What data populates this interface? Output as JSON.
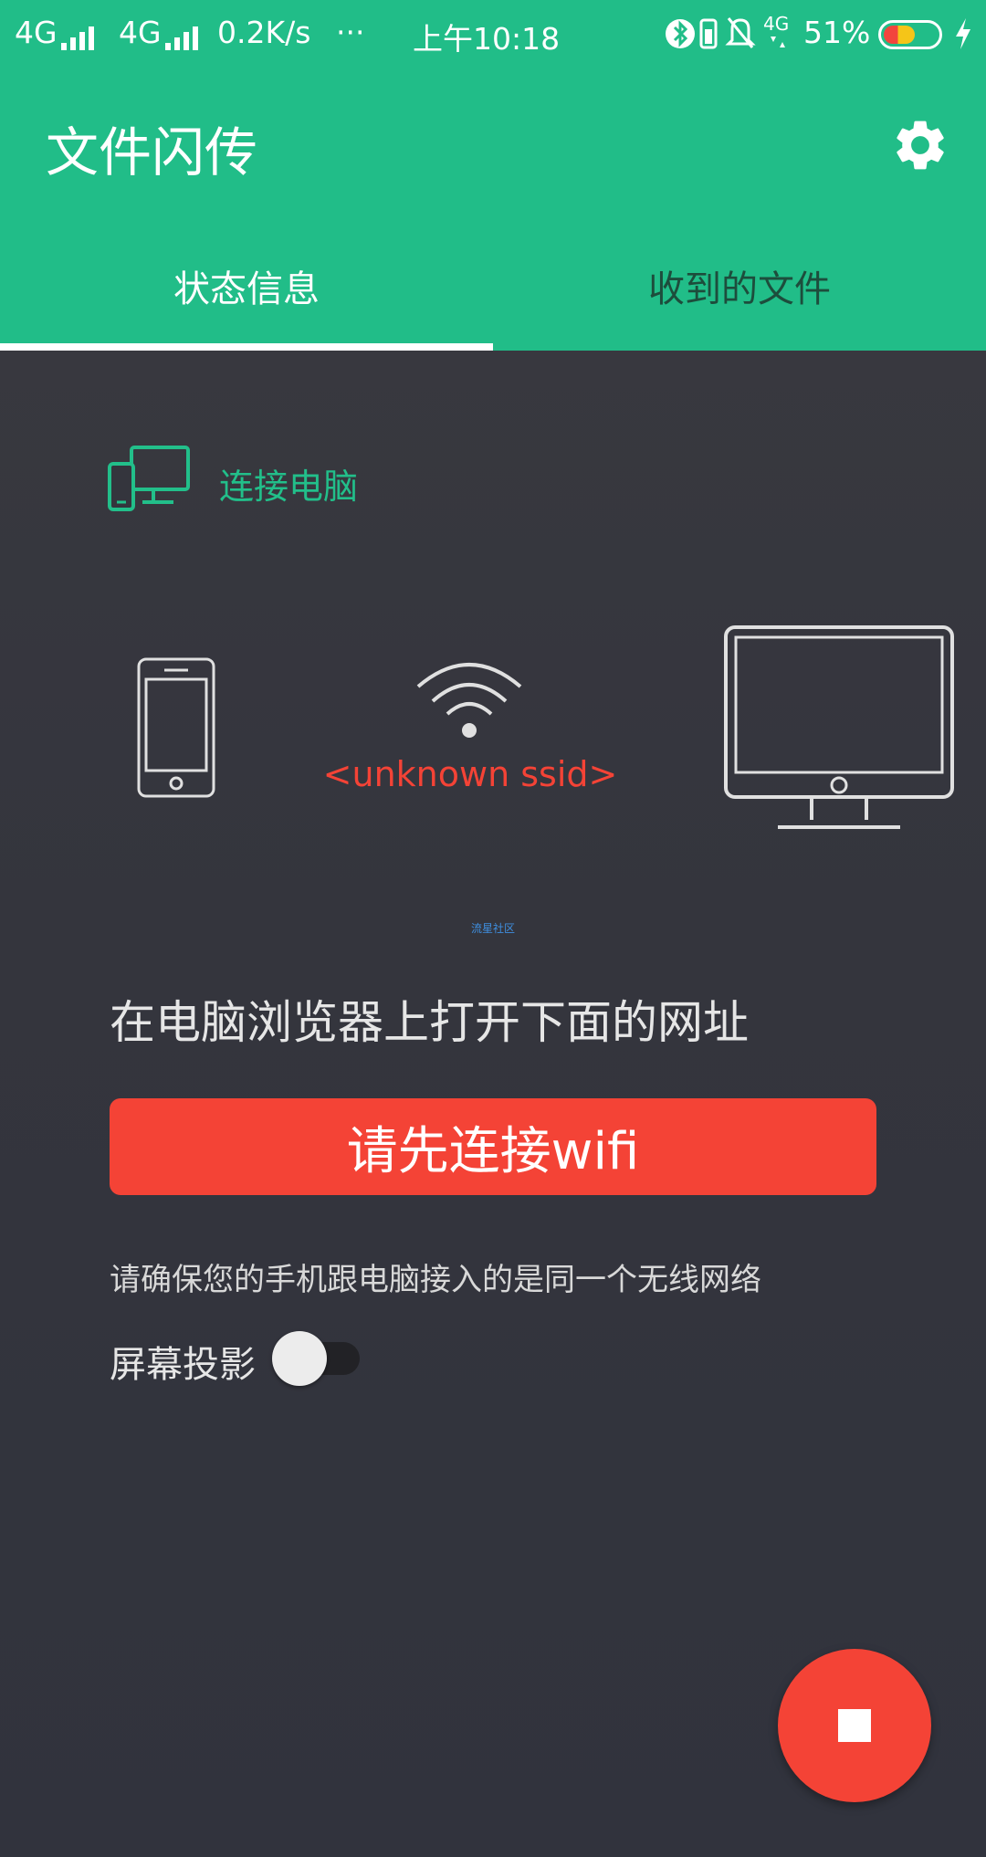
{
  "status_bar": {
    "signal1": "4G",
    "signal2": "4G",
    "speed": "0.2K/s",
    "more": "···",
    "time": "上午10:18",
    "network_badge": "4G",
    "battery": "51%"
  },
  "app": {
    "title": "文件闪传"
  },
  "tabs": [
    {
      "label": "状态信息",
      "active": true
    },
    {
      "label": "收到的文件",
      "active": false
    }
  ],
  "connect": {
    "label": "连接电脑",
    "ssid": "<unknown ssid>"
  },
  "watermark": "流星社区",
  "instruction": "在电脑浏览器上打开下面的网址",
  "wifi_button": "请先连接wifi",
  "hint": "请确保您的手机跟电脑接入的是同一个无线网络",
  "projection": {
    "label": "屏幕投影",
    "enabled": false
  },
  "colors": {
    "primary": "#21bd88",
    "accent": "#f44336",
    "background": "#34353d"
  },
  "icons": {
    "settings": "gear-icon",
    "connect": "devices-icon",
    "fab": "stop-icon"
  }
}
